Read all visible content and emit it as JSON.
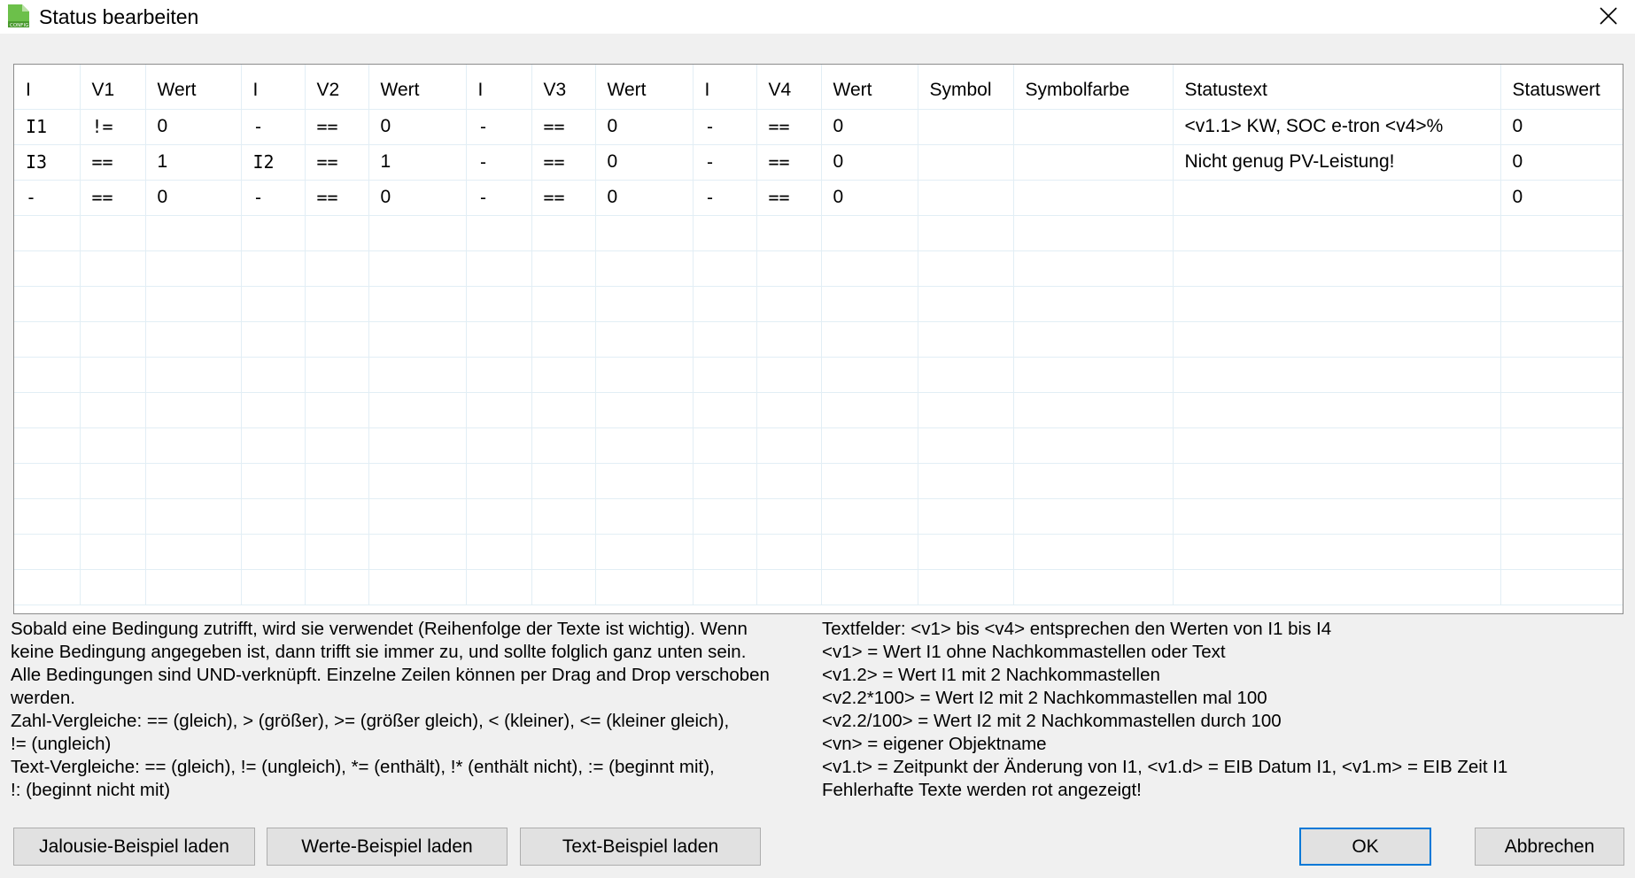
{
  "window": {
    "title": "Status bearbeiten",
    "icon": "config-icon"
  },
  "grid": {
    "columns": [
      "I",
      "V1",
      "Wert",
      "I",
      "V2",
      "Wert",
      "I",
      "V3",
      "Wert",
      "I",
      "V4",
      "Wert",
      "Symbol",
      "Symbolfarbe",
      "Statustext",
      "Statuswert"
    ],
    "rows": [
      [
        "I1",
        "!=",
        "0",
        "-",
        "==",
        "0",
        "-",
        "==",
        "0",
        "-",
        "==",
        "0",
        "",
        "",
        "<v1.1> KW, SOC e-tron <v4>%",
        "0"
      ],
      [
        "I3",
        "==",
        "1",
        "I2",
        "==",
        "1",
        "-",
        "==",
        "0",
        "-",
        "==",
        "0",
        "",
        "",
        "Nicht genug PV-Leistung!",
        "0"
      ],
      [
        "-",
        "==",
        "0",
        "-",
        "==",
        "0",
        "-",
        "==",
        "0",
        "-",
        "==",
        "0",
        "",
        "",
        "",
        "0"
      ]
    ]
  },
  "help_left": [
    "Sobald eine Bedingung zutrifft, wird sie verwendet (Reihenfolge der Texte ist wichtig). Wenn",
    "keine Bedingung angegeben ist, dann trifft sie immer zu, und sollte folglich ganz unten sein.",
    "Alle Bedingungen sind UND-verknüpft. Einzelne Zeilen können per Drag and Drop verschoben",
    "werden.",
    "Zahl-Vergleiche: == (gleich), > (größer), >= (größer gleich), < (kleiner), <= (kleiner gleich),",
    "!= (ungleich)",
    "Text-Vergleiche: == (gleich), != (ungleich), *= (enthält), !* (enthält nicht), := (beginnt mit),",
    "!: (beginnt nicht mit)"
  ],
  "help_right": [
    "Textfelder: <v1> bis <v4> entsprechen den Werten von I1 bis I4",
    "<v1> = Wert I1 ohne Nachkommastellen oder Text",
    "<v1.2> = Wert I1 mit 2 Nachkommastellen",
    "<v2.2*100> = Wert I2 mit 2 Nachkommastellen mal 100",
    "<v2.2/100> = Wert I2 mit 2 Nachkommastellen durch 100",
    "<vn> = eigener Objektname",
    "<v1.t> = Zeitpunkt der Änderung von I1, <v1.d> = EIB Datum I1, <v1.m> = EIB Zeit I1",
    "Fehlerhafte Texte werden rot angezeigt!"
  ],
  "buttons": {
    "jalousie": "Jalousie-Beispiel laden",
    "werte": "Werte-Beispiel laden",
    "text": "Text-Beispiel laden",
    "ok": "OK",
    "cancel": "Abbrechen"
  },
  "colors": {
    "window_bg": "#f0f0f0",
    "grid_line": "#e2eef5",
    "focus_border": "#0078d7",
    "icon_green": "#5cb85c"
  }
}
